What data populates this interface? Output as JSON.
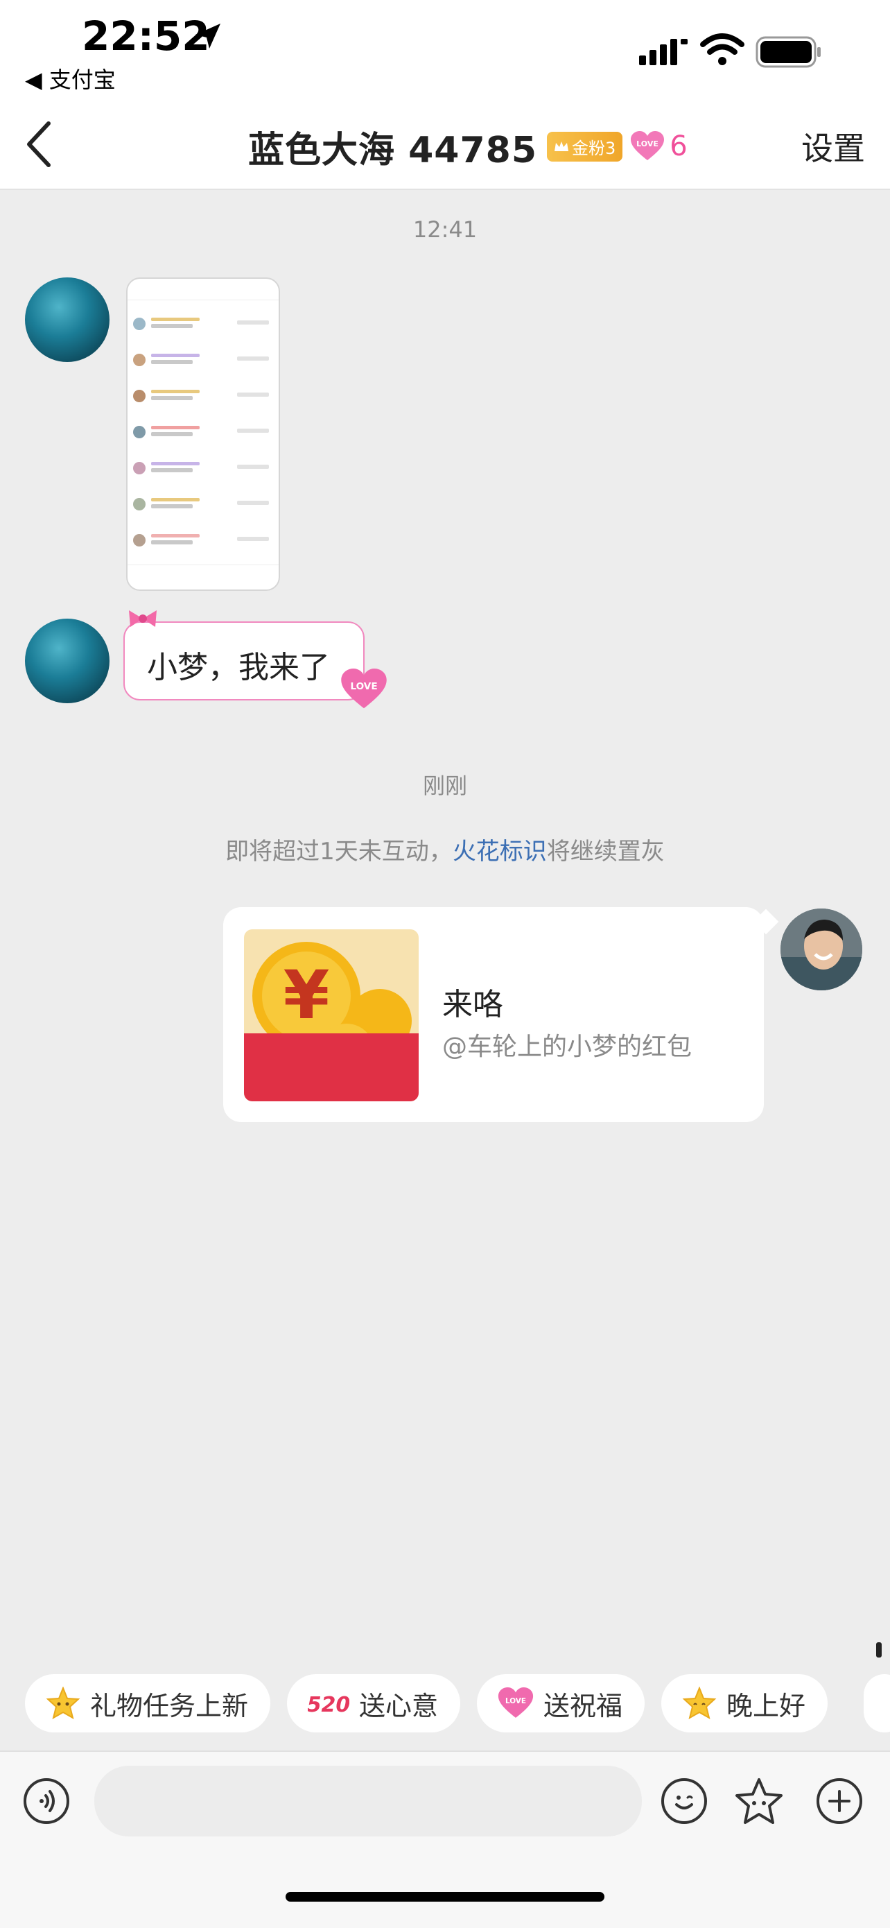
{
  "status_bar": {
    "time": "22:52",
    "back_app": "◀ 支付宝"
  },
  "header": {
    "title": "蓝色大海 44785",
    "fan_badge": "金粉3",
    "love_count": "6",
    "settings": "设置"
  },
  "messages": {
    "timestamp_1": "12:41",
    "text_message": "小梦，我来了",
    "timestamp_2": "刚刚",
    "notice_prefix": "即将超过1天未互动，",
    "notice_link": "火花标识",
    "notice_suffix": "将继续置灰",
    "red_packet": {
      "title": "来咯",
      "subtitle": "@车轮上的小梦的红包"
    }
  },
  "quick_actions": [
    {
      "label": "礼物任务上新",
      "icon": "star-icon"
    },
    {
      "label": "送心意",
      "icon": "520-icon"
    },
    {
      "label": "送祝福",
      "icon": "love-heart-icon"
    },
    {
      "label": "晚上好",
      "icon": "star-icon"
    }
  ],
  "colors": {
    "accent_pink": "#f0509a",
    "link_blue": "#3c6fb4",
    "red_packet": "#e03045",
    "background": "#ededed"
  }
}
